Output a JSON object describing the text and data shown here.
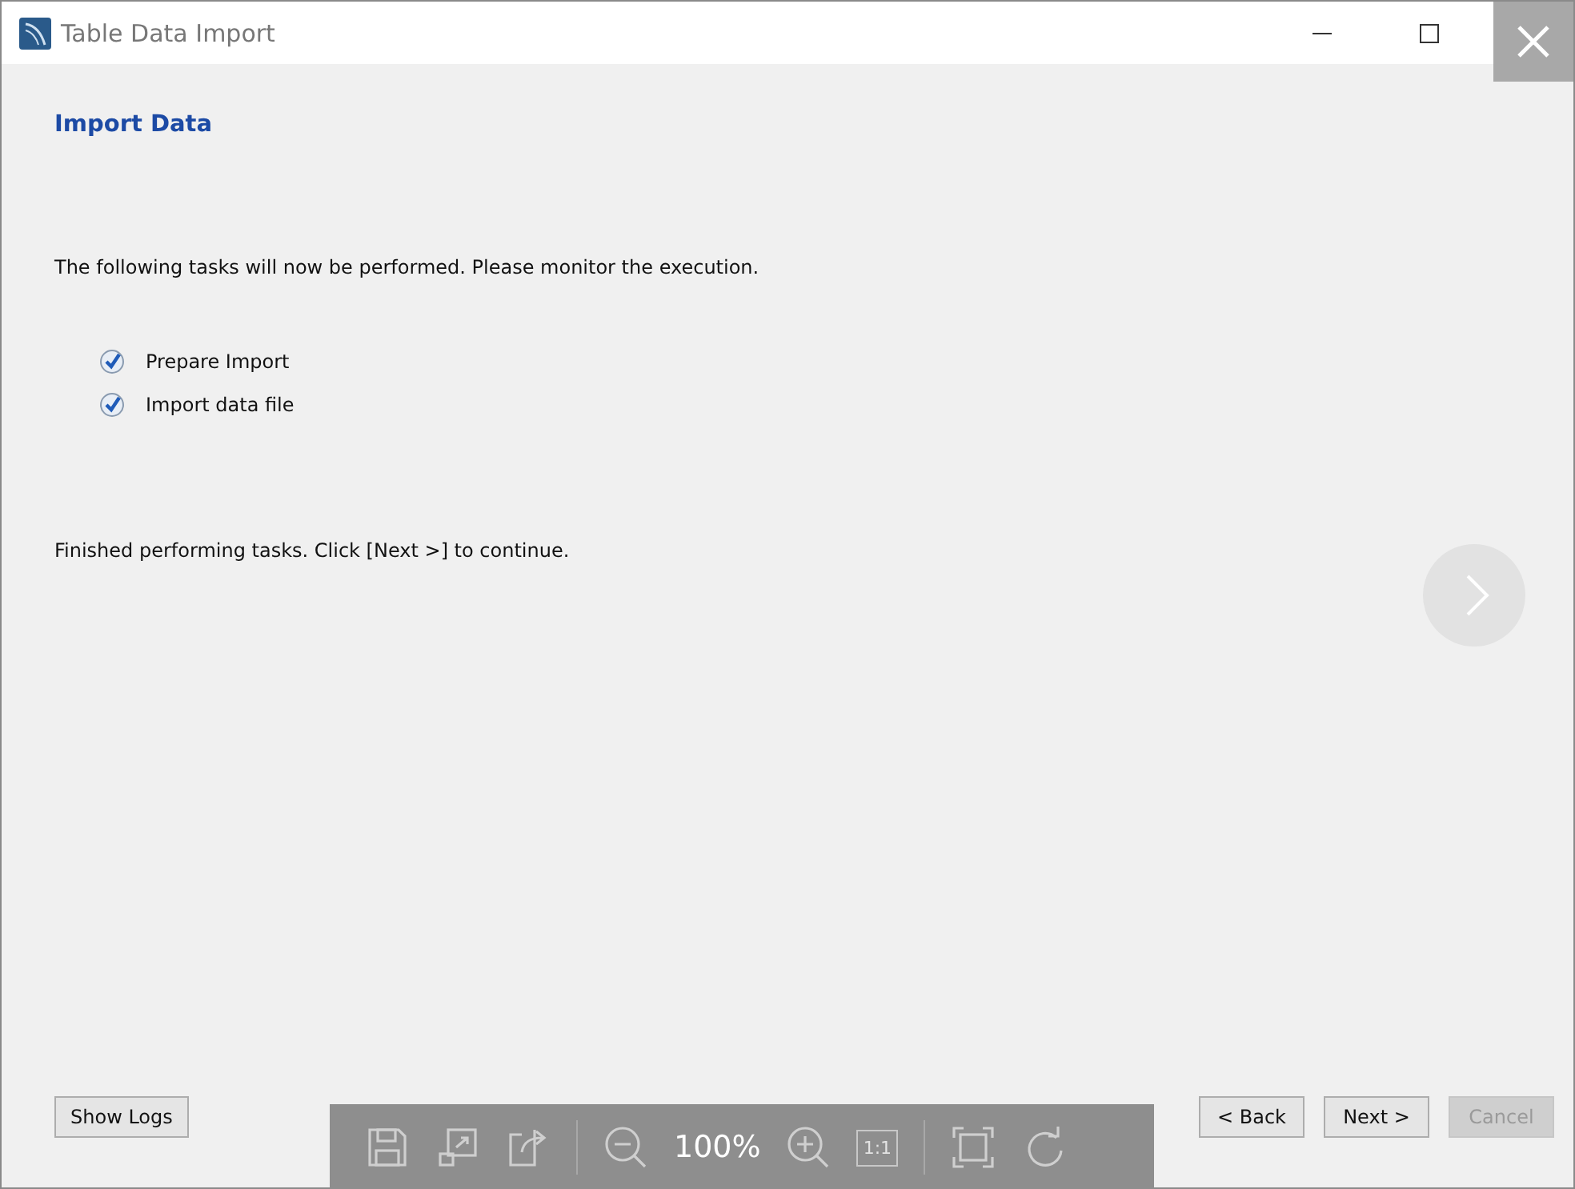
{
  "window": {
    "title": "Table Data Import"
  },
  "page": {
    "heading": "Import Data",
    "intro": "The following tasks will now be performed. Please monitor the execution.",
    "tasks": [
      {
        "label": "Prepare Import",
        "done": true
      },
      {
        "label": "Import data file",
        "done": true
      }
    ],
    "status": "Finished performing tasks. Click [Next >] to continue."
  },
  "left_buttons": [
    {
      "label": "Show Logs",
      "disabled": false
    }
  ],
  "right_buttons": [
    {
      "label": "< Back",
      "disabled": false
    },
    {
      "label": "Next >",
      "disabled": false
    },
    {
      "label": "Cancel",
      "disabled": true
    }
  ],
  "viewer": {
    "zoom": "100%",
    "actual_size": "1:1"
  }
}
